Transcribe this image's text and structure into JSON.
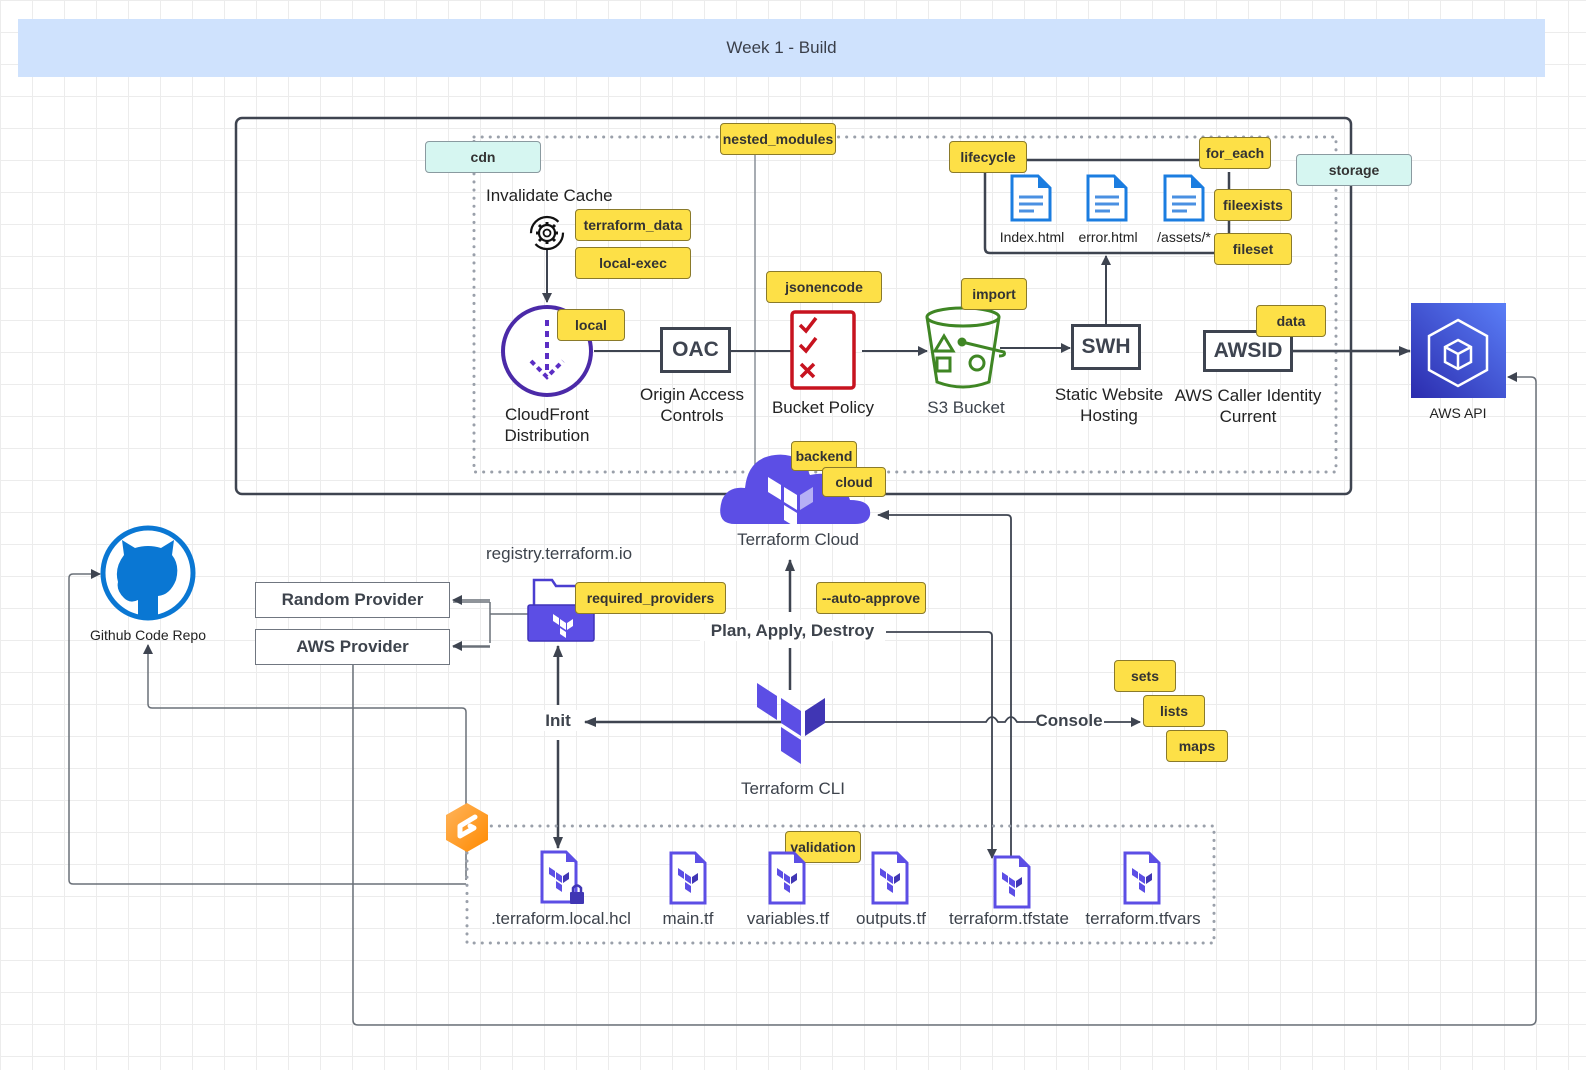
{
  "banner": {
    "title": "Week 1 - Build"
  },
  "modules": {
    "cdn": "cdn",
    "nested_modules": "nested_modules",
    "storage": "storage"
  },
  "cdn_section": {
    "invalidate_cache": "Invalidate Cache",
    "tags": {
      "terraform_data": "terraform_data",
      "local_exec": "local-exec",
      "local": "local"
    },
    "cloudfront_label_1": "CloudFront",
    "cloudfront_label_2": "Distribution",
    "oac_box": "OAC",
    "oac_label_1": "Origin Access",
    "oac_label_2": "Controls"
  },
  "storage_section": {
    "tags": {
      "jsonencode": "jsonencode",
      "import": "import",
      "lifecycle": "lifecycle",
      "for_each": "for_each",
      "fileexists": "fileexists",
      "fileset": "fileset",
      "data": "data"
    },
    "files": [
      "Index.html",
      "error.html",
      "/assets/*"
    ],
    "bucket_policy": "Bucket Policy",
    "s3_bucket": "S3 Bucket",
    "swh_box": "SWH",
    "swh_label_1": "Static Website",
    "swh_label_2": "Hosting",
    "awsid_box": "AWSID",
    "awsid_label_1": "AWS Caller Identity",
    "awsid_label_2": "Current"
  },
  "aws_api": {
    "label": "AWS API"
  },
  "terraform_cloud": {
    "label": "Terraform Cloud",
    "tags": {
      "backend": "backend",
      "cloud": "cloud"
    }
  },
  "registry": {
    "label": "registry.terraform.io",
    "tag": "required_providers",
    "providers": [
      "Random Provider",
      "AWS Provider"
    ]
  },
  "github": {
    "label": "Github Code Repo"
  },
  "cli": {
    "label": "Terraform CLI",
    "init": "Init",
    "plan_apply_destroy": "Plan, Apply, Destroy",
    "console": "Console",
    "auto_approve_tag": "--auto-approve",
    "console_tags": [
      "sets",
      "lists",
      "maps"
    ]
  },
  "workspace_files": {
    "validation_tag": "validation",
    "files": [
      ".terraform.local.hcl",
      "main.tf",
      "variables.tf",
      "outputs.tf",
      "terraform.tfstate",
      "terraform.tfvars"
    ]
  },
  "colors": {
    "terraform_purple": "#5c4ee5",
    "aws_blue": "#3b48cc",
    "github_blue": "#0a77d3",
    "s3_green": "#3f8624",
    "policy_red": "#c7131f",
    "tag_yellow": "#fde047",
    "module_mint": "#d6f6f1",
    "banner_blue": "#cfe2fd"
  }
}
